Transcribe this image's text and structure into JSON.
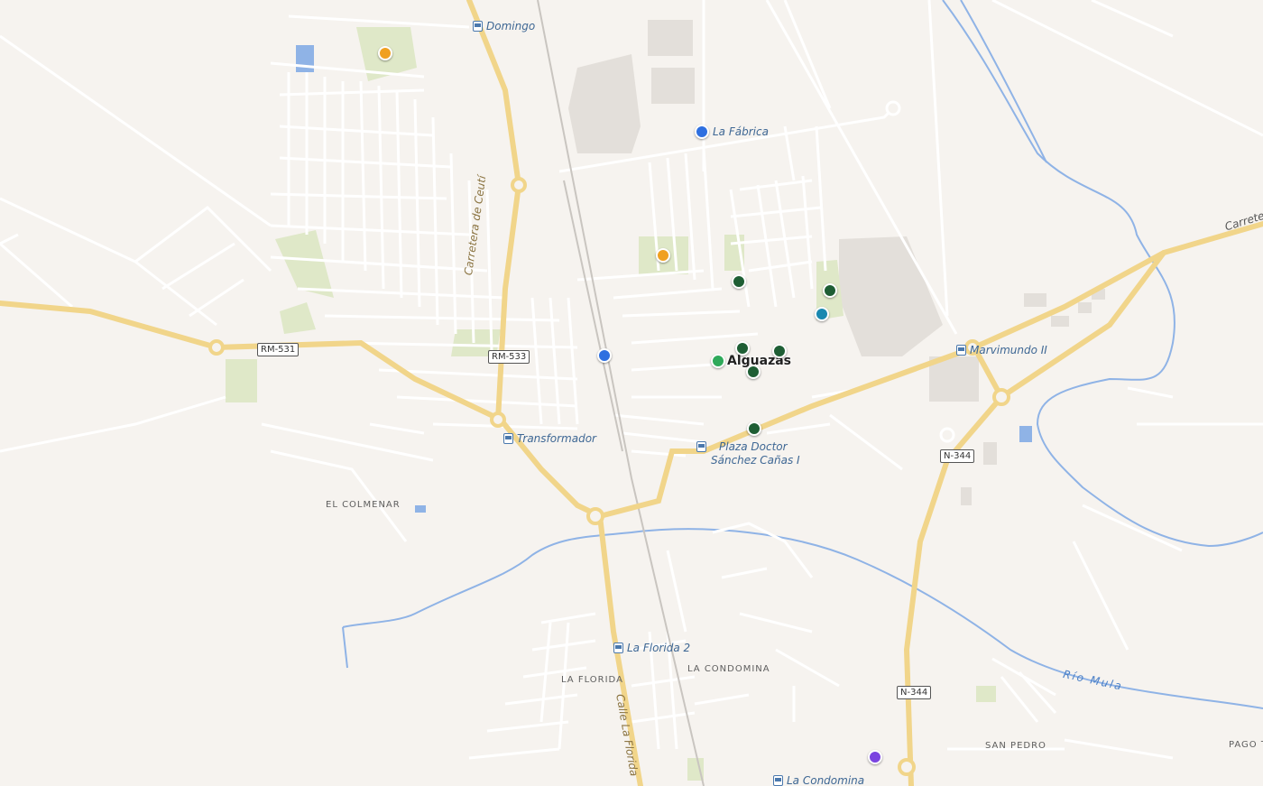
{
  "map": {
    "colors": {
      "background": "#f6f3ef",
      "major_road": "#f1d58a",
      "minor_road": "#ffffff",
      "river": "#8fb3e6",
      "park": "#dfe8c8",
      "building": "#e1ddd8",
      "bus_stop": "#3e6794"
    },
    "bus_stops": {
      "domingo": "Domingo",
      "la_fabrica": "La Fábrica",
      "marvimundo": "Marvimundo II",
      "transformador": "Transformador",
      "plaza_doctor_1": "Plaza Doctor",
      "plaza_doctor_2": "Sánchez Cañas I",
      "la_florida_2": "La Florida 2",
      "la_condomina_stop": "La Condomina"
    },
    "places": {
      "town": "Alguazas",
      "el_colmenar": "EL COLMENAR",
      "la_florida": "LA FLORIDA",
      "la_condomina": "LA CONDOMINA",
      "san_pedro": "SAN PEDRO",
      "pago": "PAGO T"
    },
    "roads": {
      "rm531": "RM-531",
      "rm533": "RM-533",
      "n344_a": "N-344",
      "n344_b": "N-344",
      "carretera_ceuti": "Carretera de Ceutí",
      "calle_la_florida": "Calle La Florida",
      "carretera_e": "Carrete"
    },
    "river": "Río Mula",
    "pois": [
      {
        "name": "poi-orange-north",
        "color": "#f0a020"
      },
      {
        "name": "poi-orange-center",
        "color": "#f0a020"
      },
      {
        "name": "poi-blue-la-fabrica",
        "color": "#2e6fe0"
      },
      {
        "name": "poi-blue-station",
        "color": "#2e6fe0"
      },
      {
        "name": "poi-darkgreen-1",
        "color": "#1e5e34"
      },
      {
        "name": "poi-darkgreen-2",
        "color": "#1e5e34"
      },
      {
        "name": "poi-darkgreen-3",
        "color": "#1e5e34"
      },
      {
        "name": "poi-darkgreen-4",
        "color": "#1e5e34"
      },
      {
        "name": "poi-darkgreen-5",
        "color": "#1e5e34"
      },
      {
        "name": "poi-darkgreen-6",
        "color": "#1e5e34"
      },
      {
        "name": "poi-green-light",
        "color": "#2fa95a"
      },
      {
        "name": "poi-teal",
        "color": "#1a88b0"
      },
      {
        "name": "poi-purple",
        "color": "#7b44e0"
      }
    ]
  }
}
